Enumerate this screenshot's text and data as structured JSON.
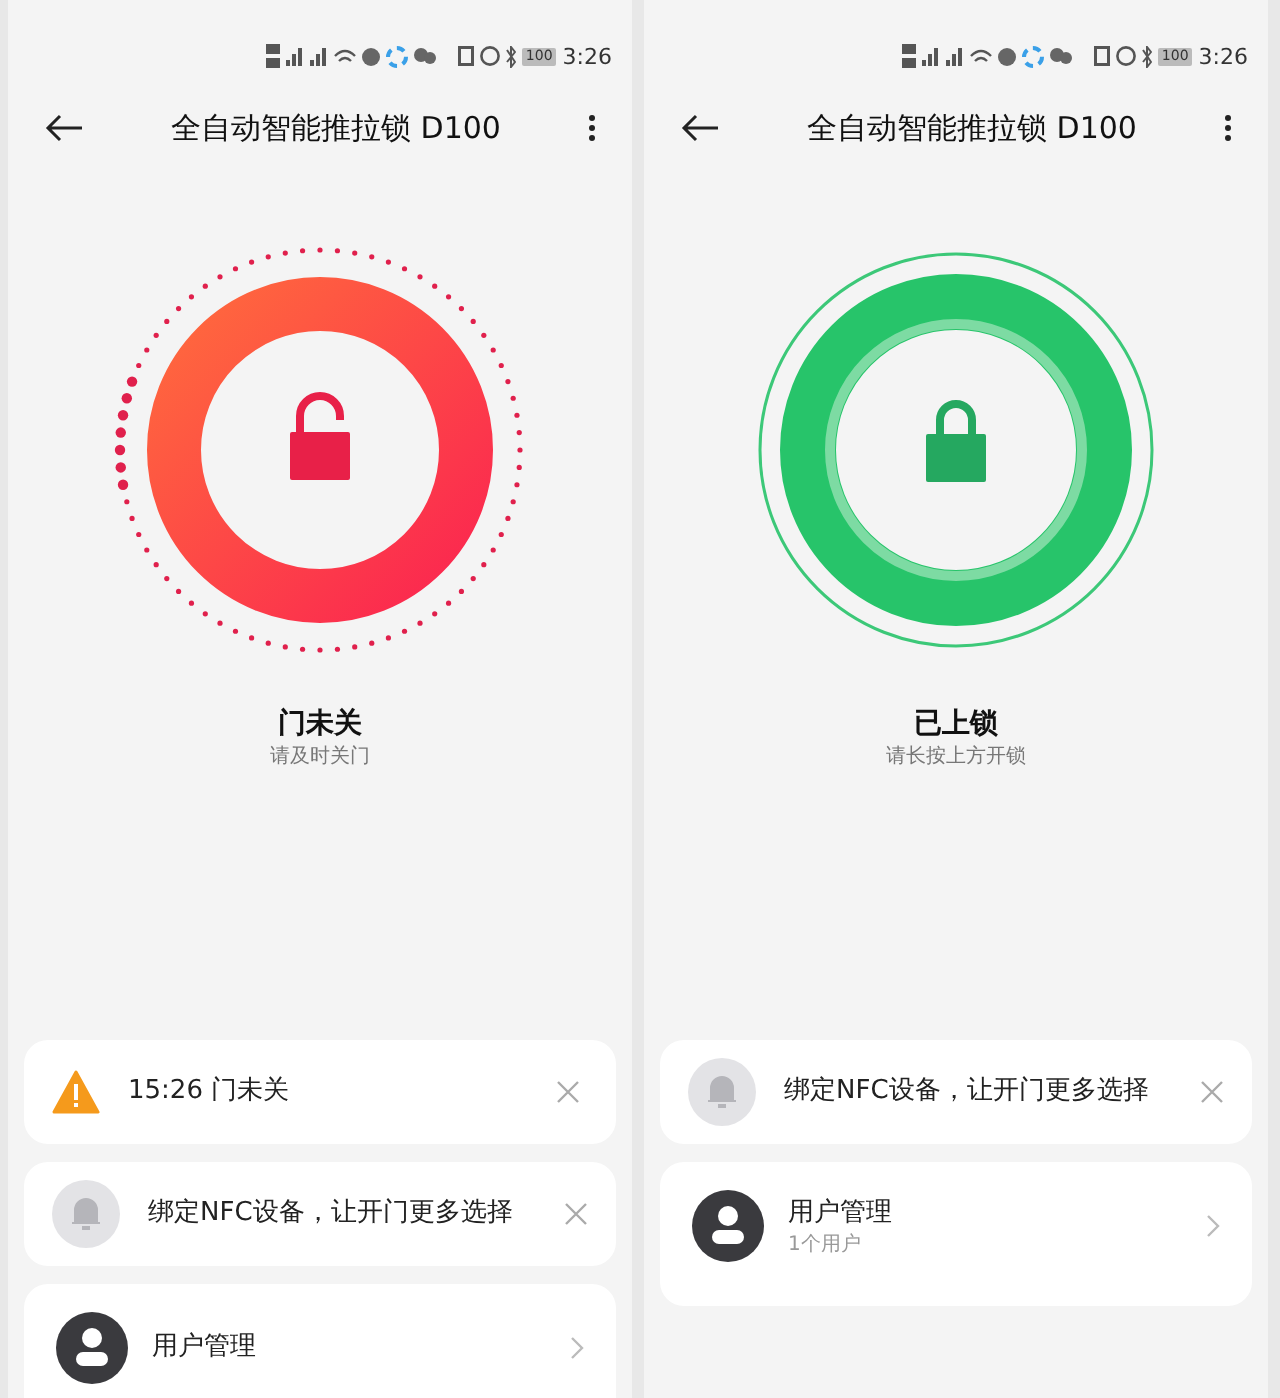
{
  "screens": [
    {
      "status_bar": {
        "battery": "100",
        "time": "3:26"
      },
      "title": "全自动智能推拉锁 D100",
      "lock": {
        "kind": "open",
        "status": "门未关",
        "hint": "请及时关门"
      },
      "cards": [
        {
          "kind": "alert",
          "text": "15:26 门未关"
        },
        {
          "kind": "notice",
          "text": "绑定NFC设备，让开门更多选择"
        },
        {
          "kind": "menu",
          "items": [
            {
              "title": "用户管理"
            }
          ]
        }
      ]
    },
    {
      "status_bar": {
        "battery": "100",
        "time": "3:26"
      },
      "title": "全自动智能推拉锁 D100",
      "lock": {
        "kind": "locked",
        "status": "已上锁",
        "hint": "请长按上方开锁"
      },
      "cards": [
        {
          "kind": "notice",
          "text": "绑定NFC设备，让开门更多选择"
        },
        {
          "kind": "menu",
          "items": [
            {
              "title": "用户管理",
              "subtitle": "1个用户"
            }
          ]
        }
      ]
    }
  ]
}
